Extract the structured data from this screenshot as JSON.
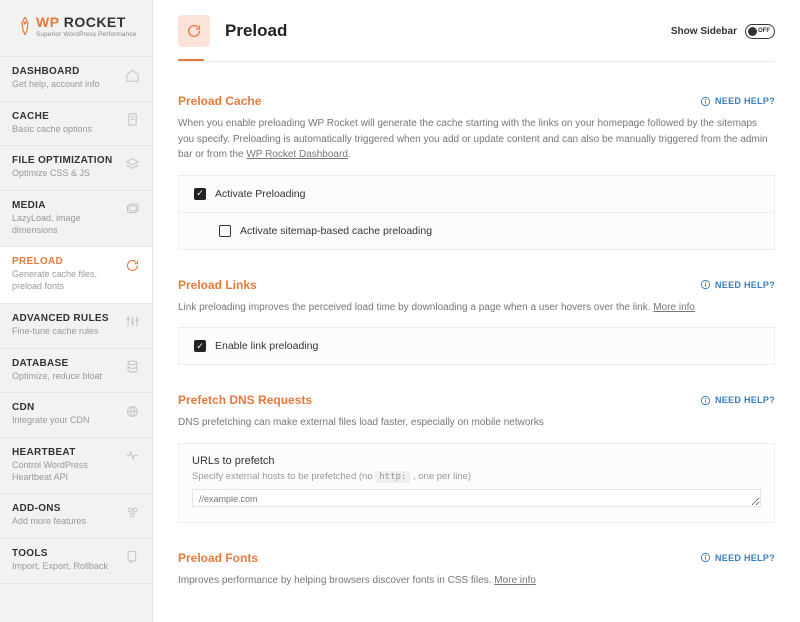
{
  "brand": {
    "wp": "WP",
    "rocket": "ROCKET",
    "tagline": "Superior WordPress Performance"
  },
  "nav": [
    {
      "title": "DASHBOARD",
      "sub": "Get help, account info"
    },
    {
      "title": "CACHE",
      "sub": "Basic cache options"
    },
    {
      "title": "FILE OPTIMIZATION",
      "sub": "Optimize CSS & JS"
    },
    {
      "title": "MEDIA",
      "sub": "LazyLoad, image dimensions"
    },
    {
      "title": "PRELOAD",
      "sub": "Generate cache files, preload fonts"
    },
    {
      "title": "ADVANCED RULES",
      "sub": "Fine-tune cache rules"
    },
    {
      "title": "DATABASE",
      "sub": "Optimize, reduce bloat"
    },
    {
      "title": "CDN",
      "sub": "Integrate your CDN"
    },
    {
      "title": "HEARTBEAT",
      "sub": "Control WordPress Heartbeat API"
    },
    {
      "title": "ADD-ONS",
      "sub": "Add more features"
    },
    {
      "title": "TOOLS",
      "sub": "Import, Export, Rollback"
    }
  ],
  "page": {
    "title": "Preload",
    "show_sidebar": "Show Sidebar",
    "toggle_state": "OFF"
  },
  "help": {
    "label": "NEED HELP?"
  },
  "preload_cache": {
    "title": "Preload Cache",
    "desc_pre": "When you enable preloading WP Rocket will generate the cache starting with the links on your homepage followed by the sitemaps you specify. Preloading is automatically triggered when you add or update content and can also be manually triggered from the admin bar or from the ",
    "desc_link": "WP Rocket Dashboard",
    "opt1": "Activate Preloading",
    "opt2": "Activate sitemap-based cache preloading"
  },
  "preload_links": {
    "title": "Preload Links",
    "desc": "Link preloading improves the perceived load time by downloading a page when a user hovers over the link. ",
    "more": "More info",
    "opt1": "Enable link preloading"
  },
  "prefetch": {
    "title": "Prefetch DNS Requests",
    "desc": "DNS prefetching can make external files load faster, especially on mobile networks",
    "field_title": "URLs to prefetch",
    "field_sub_pre": "Specify external hosts to be prefetched (no ",
    "field_sub_code": "http:",
    "field_sub_post": " , one per line)",
    "placeholder": "//example.com"
  },
  "preload_fonts": {
    "title": "Preload Fonts",
    "desc": "Improves performance by helping browsers discover fonts in CSS files. ",
    "more": "More info"
  }
}
